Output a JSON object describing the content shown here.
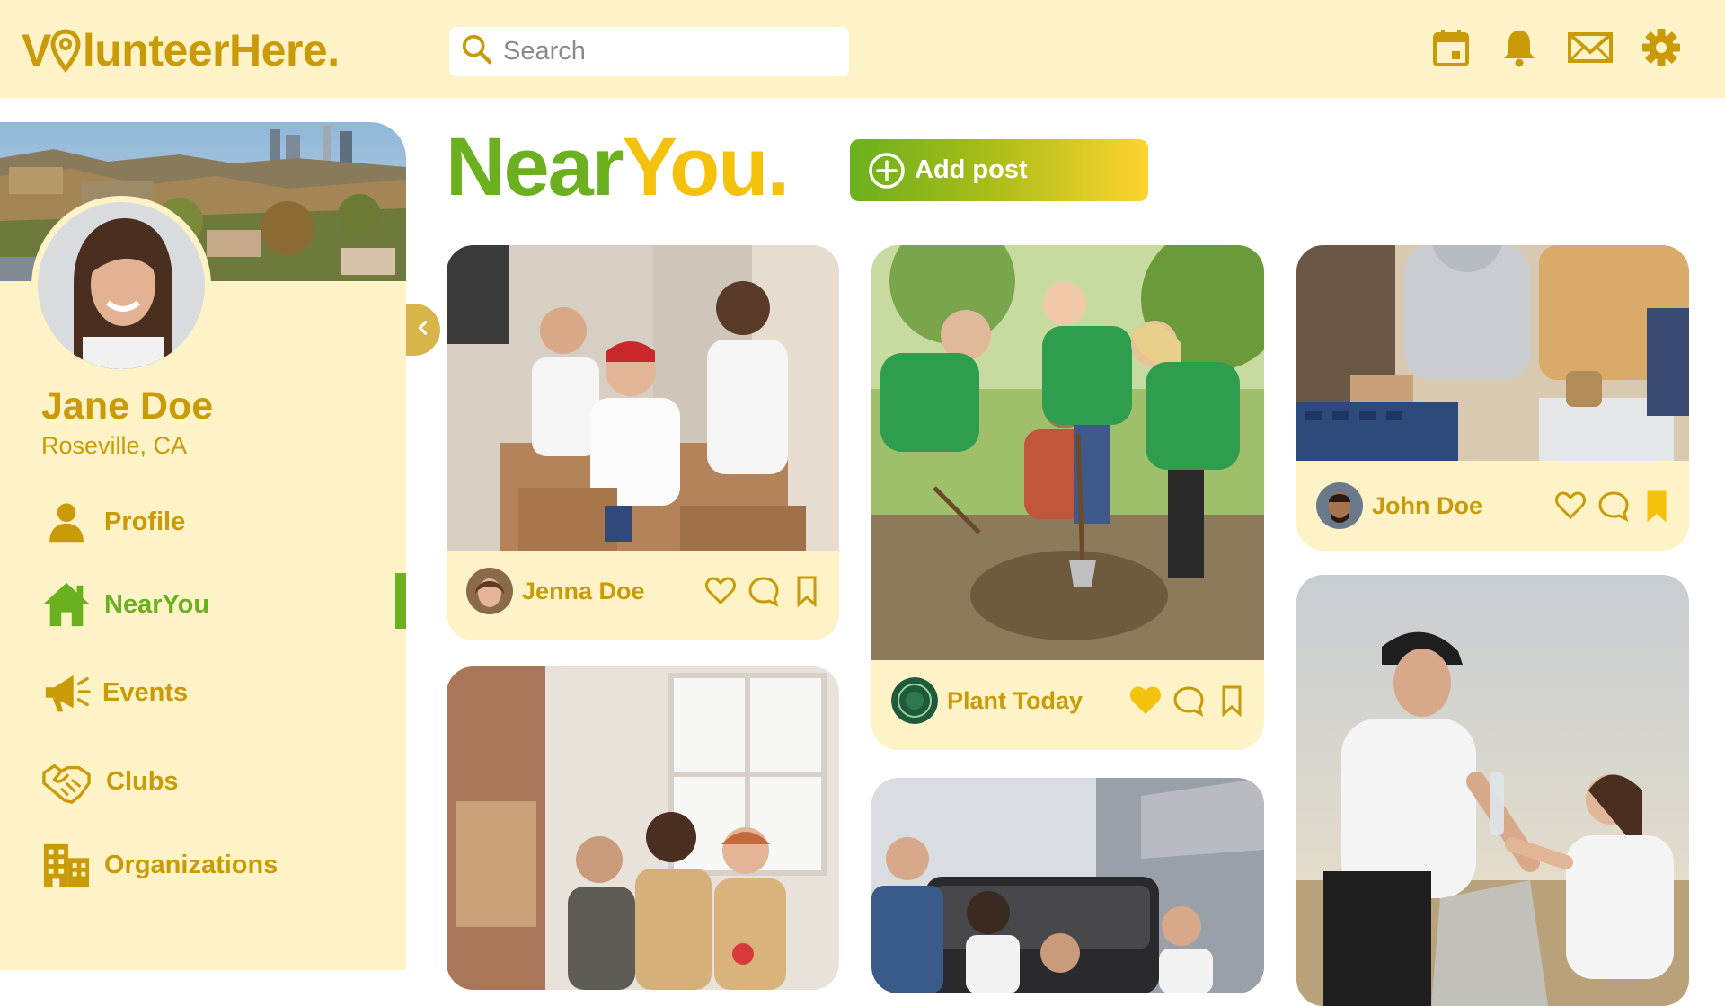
{
  "app": {
    "logo_text_start": "V",
    "logo_text_rest": "lunteerHere."
  },
  "search": {
    "placeholder": "Search"
  },
  "top_icons": [
    "calendar-icon",
    "bell-icon",
    "mail-icon",
    "gear-icon"
  ],
  "user": {
    "name": "Jane Doe",
    "location": "Roseville, CA"
  },
  "nav": {
    "items": [
      {
        "label": "Profile",
        "icon": "person-icon",
        "active": false
      },
      {
        "label": "NearYou",
        "icon": "home-icon",
        "active": true
      },
      {
        "label": "Events",
        "icon": "megaphone-icon",
        "active": false
      },
      {
        "label": "Clubs",
        "icon": "handshake-icon",
        "active": false
      },
      {
        "label": "Organizations",
        "icon": "building-icon",
        "active": false
      }
    ]
  },
  "page": {
    "title_part1": "Near",
    "title_part2": "You.",
    "add_post_label": "Add post"
  },
  "posts": [
    {
      "author": "Jenna Doe",
      "liked": false,
      "saved": false
    },
    {
      "author": "Plant Today",
      "liked": true,
      "saved": false
    },
    {
      "author": "John Doe",
      "liked": false,
      "saved": true
    }
  ],
  "colors": {
    "brand_gold": "#C99B08",
    "green": "#6BB01E",
    "yellow": "#F4C20D",
    "panel": "#FEF2C7"
  }
}
